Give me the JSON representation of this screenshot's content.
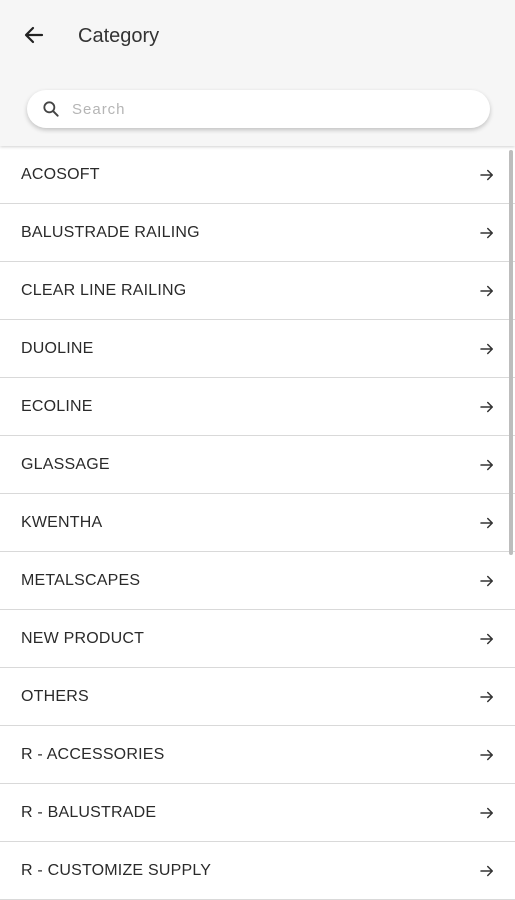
{
  "header": {
    "title": "Category",
    "back_icon": "arrow-left-icon"
  },
  "search": {
    "placeholder": "Search",
    "value": "",
    "icon": "search-icon"
  },
  "categories": [
    {
      "label": "ACOSOFT"
    },
    {
      "label": "BALUSTRADE RAILING"
    },
    {
      "label": "CLEAR LINE RAILING"
    },
    {
      "label": "DUOLINE"
    },
    {
      "label": "ECOLINE"
    },
    {
      "label": "GLASSAGE"
    },
    {
      "label": "KWENTHA"
    },
    {
      "label": "METALSCAPES"
    },
    {
      "label": "NEW PRODUCT"
    },
    {
      "label": "OTHERS"
    },
    {
      "label": "R - ACCESSORIES"
    },
    {
      "label": "R - BALUSTRADE"
    },
    {
      "label": "R - CUSTOMIZE SUPPLY"
    }
  ],
  "colors": {
    "header_bg": "#f6f6f6",
    "text": "#2a2a2a",
    "divider": "#d9d9d9",
    "placeholder": "#b5b5b5"
  }
}
